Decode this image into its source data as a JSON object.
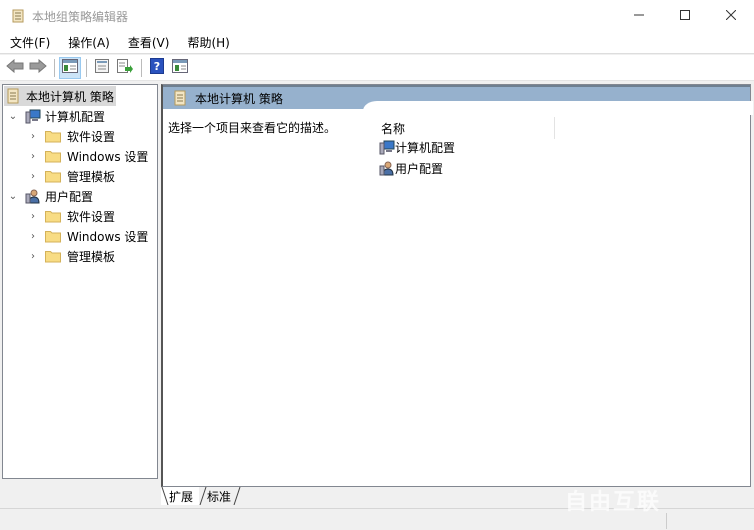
{
  "window": {
    "title": "本地组策略编辑器",
    "minimize_icon": "minimize-icon",
    "maximize_icon": "maximize-icon",
    "close_icon": "close-icon"
  },
  "menubar": {
    "items": [
      {
        "label": "文件(F)"
      },
      {
        "label": "操作(A)"
      },
      {
        "label": "查看(V)"
      },
      {
        "label": "帮助(H)"
      }
    ]
  },
  "toolbar": {
    "buttons": [
      "back-icon",
      "forward-icon",
      "show-hide-tree-icon",
      "properties-icon",
      "export-list-icon",
      "help-icon",
      "show-hide-action-pane-icon"
    ]
  },
  "tree": {
    "root": "本地计算机 策略",
    "computer_config": {
      "label": "计算机配置",
      "children": [
        "软件设置",
        "Windows 设置",
        "管理模板"
      ]
    },
    "user_config": {
      "label": "用户配置",
      "children": [
        "软件设置",
        "Windows 设置",
        "管理模板"
      ]
    }
  },
  "details": {
    "header_title": "本地计算机 策略",
    "description": "选择一个项目来查看它的描述。",
    "column_name": "名称",
    "items": [
      {
        "label": "计算机配置",
        "icon": "computer-icon"
      },
      {
        "label": "用户配置",
        "icon": "user-icon"
      }
    ]
  },
  "tabs": [
    {
      "label": "扩展",
      "active": true
    },
    {
      "label": "标准",
      "active": false
    }
  ],
  "watermark": "自由互联"
}
